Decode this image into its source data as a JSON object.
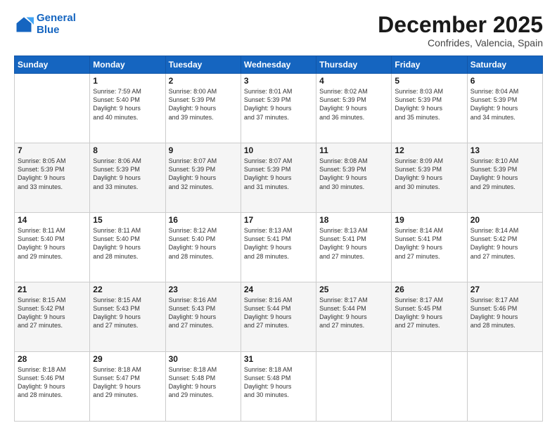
{
  "logo": {
    "line1": "General",
    "line2": "Blue"
  },
  "title": "December 2025",
  "subtitle": "Confrides, Valencia, Spain",
  "headers": [
    "Sunday",
    "Monday",
    "Tuesday",
    "Wednesday",
    "Thursday",
    "Friday",
    "Saturday"
  ],
  "weeks": [
    [
      {
        "num": "",
        "info": ""
      },
      {
        "num": "1",
        "info": "Sunrise: 7:59 AM\nSunset: 5:40 PM\nDaylight: 9 hours\nand 40 minutes."
      },
      {
        "num": "2",
        "info": "Sunrise: 8:00 AM\nSunset: 5:39 PM\nDaylight: 9 hours\nand 39 minutes."
      },
      {
        "num": "3",
        "info": "Sunrise: 8:01 AM\nSunset: 5:39 PM\nDaylight: 9 hours\nand 37 minutes."
      },
      {
        "num": "4",
        "info": "Sunrise: 8:02 AM\nSunset: 5:39 PM\nDaylight: 9 hours\nand 36 minutes."
      },
      {
        "num": "5",
        "info": "Sunrise: 8:03 AM\nSunset: 5:39 PM\nDaylight: 9 hours\nand 35 minutes."
      },
      {
        "num": "6",
        "info": "Sunrise: 8:04 AM\nSunset: 5:39 PM\nDaylight: 9 hours\nand 34 minutes."
      }
    ],
    [
      {
        "num": "7",
        "info": "Sunrise: 8:05 AM\nSunset: 5:39 PM\nDaylight: 9 hours\nand 33 minutes."
      },
      {
        "num": "8",
        "info": "Sunrise: 8:06 AM\nSunset: 5:39 PM\nDaylight: 9 hours\nand 33 minutes."
      },
      {
        "num": "9",
        "info": "Sunrise: 8:07 AM\nSunset: 5:39 PM\nDaylight: 9 hours\nand 32 minutes."
      },
      {
        "num": "10",
        "info": "Sunrise: 8:07 AM\nSunset: 5:39 PM\nDaylight: 9 hours\nand 31 minutes."
      },
      {
        "num": "11",
        "info": "Sunrise: 8:08 AM\nSunset: 5:39 PM\nDaylight: 9 hours\nand 30 minutes."
      },
      {
        "num": "12",
        "info": "Sunrise: 8:09 AM\nSunset: 5:39 PM\nDaylight: 9 hours\nand 30 minutes."
      },
      {
        "num": "13",
        "info": "Sunrise: 8:10 AM\nSunset: 5:39 PM\nDaylight: 9 hours\nand 29 minutes."
      }
    ],
    [
      {
        "num": "14",
        "info": "Sunrise: 8:11 AM\nSunset: 5:40 PM\nDaylight: 9 hours\nand 29 minutes."
      },
      {
        "num": "15",
        "info": "Sunrise: 8:11 AM\nSunset: 5:40 PM\nDaylight: 9 hours\nand 28 minutes."
      },
      {
        "num": "16",
        "info": "Sunrise: 8:12 AM\nSunset: 5:40 PM\nDaylight: 9 hours\nand 28 minutes."
      },
      {
        "num": "17",
        "info": "Sunrise: 8:13 AM\nSunset: 5:41 PM\nDaylight: 9 hours\nand 28 minutes."
      },
      {
        "num": "18",
        "info": "Sunrise: 8:13 AM\nSunset: 5:41 PM\nDaylight: 9 hours\nand 27 minutes."
      },
      {
        "num": "19",
        "info": "Sunrise: 8:14 AM\nSunset: 5:41 PM\nDaylight: 9 hours\nand 27 minutes."
      },
      {
        "num": "20",
        "info": "Sunrise: 8:14 AM\nSunset: 5:42 PM\nDaylight: 9 hours\nand 27 minutes."
      }
    ],
    [
      {
        "num": "21",
        "info": "Sunrise: 8:15 AM\nSunset: 5:42 PM\nDaylight: 9 hours\nand 27 minutes."
      },
      {
        "num": "22",
        "info": "Sunrise: 8:15 AM\nSunset: 5:43 PM\nDaylight: 9 hours\nand 27 minutes."
      },
      {
        "num": "23",
        "info": "Sunrise: 8:16 AM\nSunset: 5:43 PM\nDaylight: 9 hours\nand 27 minutes."
      },
      {
        "num": "24",
        "info": "Sunrise: 8:16 AM\nSunset: 5:44 PM\nDaylight: 9 hours\nand 27 minutes."
      },
      {
        "num": "25",
        "info": "Sunrise: 8:17 AM\nSunset: 5:44 PM\nDaylight: 9 hours\nand 27 minutes."
      },
      {
        "num": "26",
        "info": "Sunrise: 8:17 AM\nSunset: 5:45 PM\nDaylight: 9 hours\nand 27 minutes."
      },
      {
        "num": "27",
        "info": "Sunrise: 8:17 AM\nSunset: 5:46 PM\nDaylight: 9 hours\nand 28 minutes."
      }
    ],
    [
      {
        "num": "28",
        "info": "Sunrise: 8:18 AM\nSunset: 5:46 PM\nDaylight: 9 hours\nand 28 minutes."
      },
      {
        "num": "29",
        "info": "Sunrise: 8:18 AM\nSunset: 5:47 PM\nDaylight: 9 hours\nand 29 minutes."
      },
      {
        "num": "30",
        "info": "Sunrise: 8:18 AM\nSunset: 5:48 PM\nDaylight: 9 hours\nand 29 minutes."
      },
      {
        "num": "31",
        "info": "Sunrise: 8:18 AM\nSunset: 5:48 PM\nDaylight: 9 hours\nand 30 minutes."
      },
      {
        "num": "",
        "info": ""
      },
      {
        "num": "",
        "info": ""
      },
      {
        "num": "",
        "info": ""
      }
    ]
  ]
}
